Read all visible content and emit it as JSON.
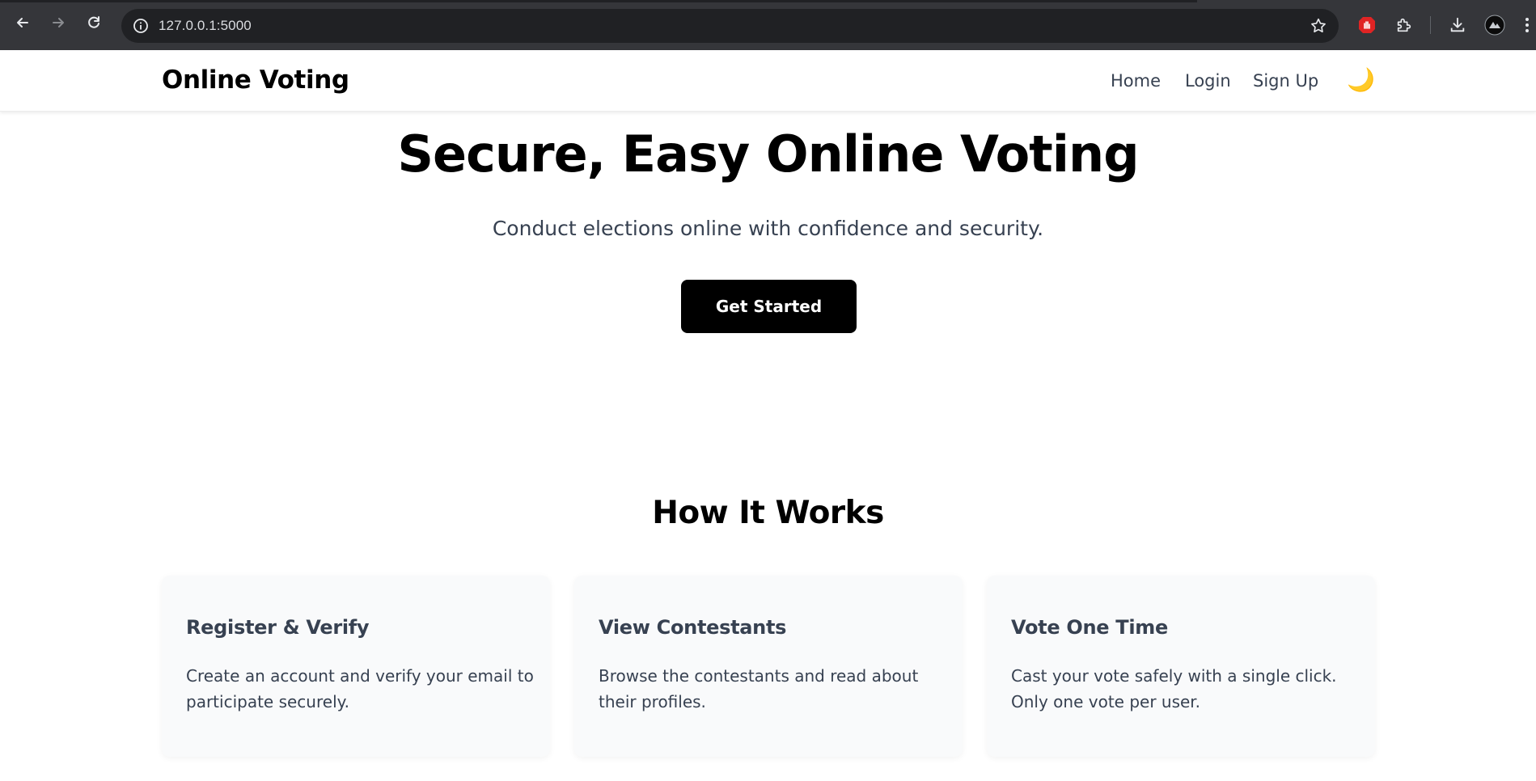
{
  "browser": {
    "url": "127.0.0.1:5000",
    "icons": {
      "back": "back-arrow-icon",
      "forward": "forward-arrow-icon",
      "reload": "reload-icon",
      "site_info": "info-icon",
      "bookmark": "star-icon",
      "extension_block": "hand-stop-icon",
      "extensions": "puzzle-icon",
      "downloads": "download-icon",
      "profile": "avatar",
      "menu": "kebab-menu-icon"
    }
  },
  "header": {
    "brand": "Online Voting",
    "nav": [
      {
        "label": "Home"
      },
      {
        "label": "Login"
      },
      {
        "label": "Sign Up"
      }
    ],
    "theme_toggle": "🌙"
  },
  "hero": {
    "title": "Secure, Easy Online Voting",
    "subtitle": "Conduct elections online with confidence and security.",
    "cta_label": "Get Started"
  },
  "how_it_works": {
    "title": "How It Works",
    "cards": [
      {
        "title": "Register & Verify",
        "text": "Create an account and verify your email to participate securely."
      },
      {
        "title": "View Contestants",
        "text": "Browse the contestants and read about their profiles."
      },
      {
        "title": "Vote One Time",
        "text": "Cast your vote safely with a single click. Only one vote per user."
      }
    ]
  },
  "colors": {
    "chrome_bg": "#35363a",
    "omnibox_bg": "#202124",
    "text_dark": "#000000",
    "text_muted": "#374151",
    "card_bg": "#f9fafb",
    "cta_bg": "#000000",
    "cta_text": "#ffffff",
    "stop_ext_red": "#e02424"
  }
}
